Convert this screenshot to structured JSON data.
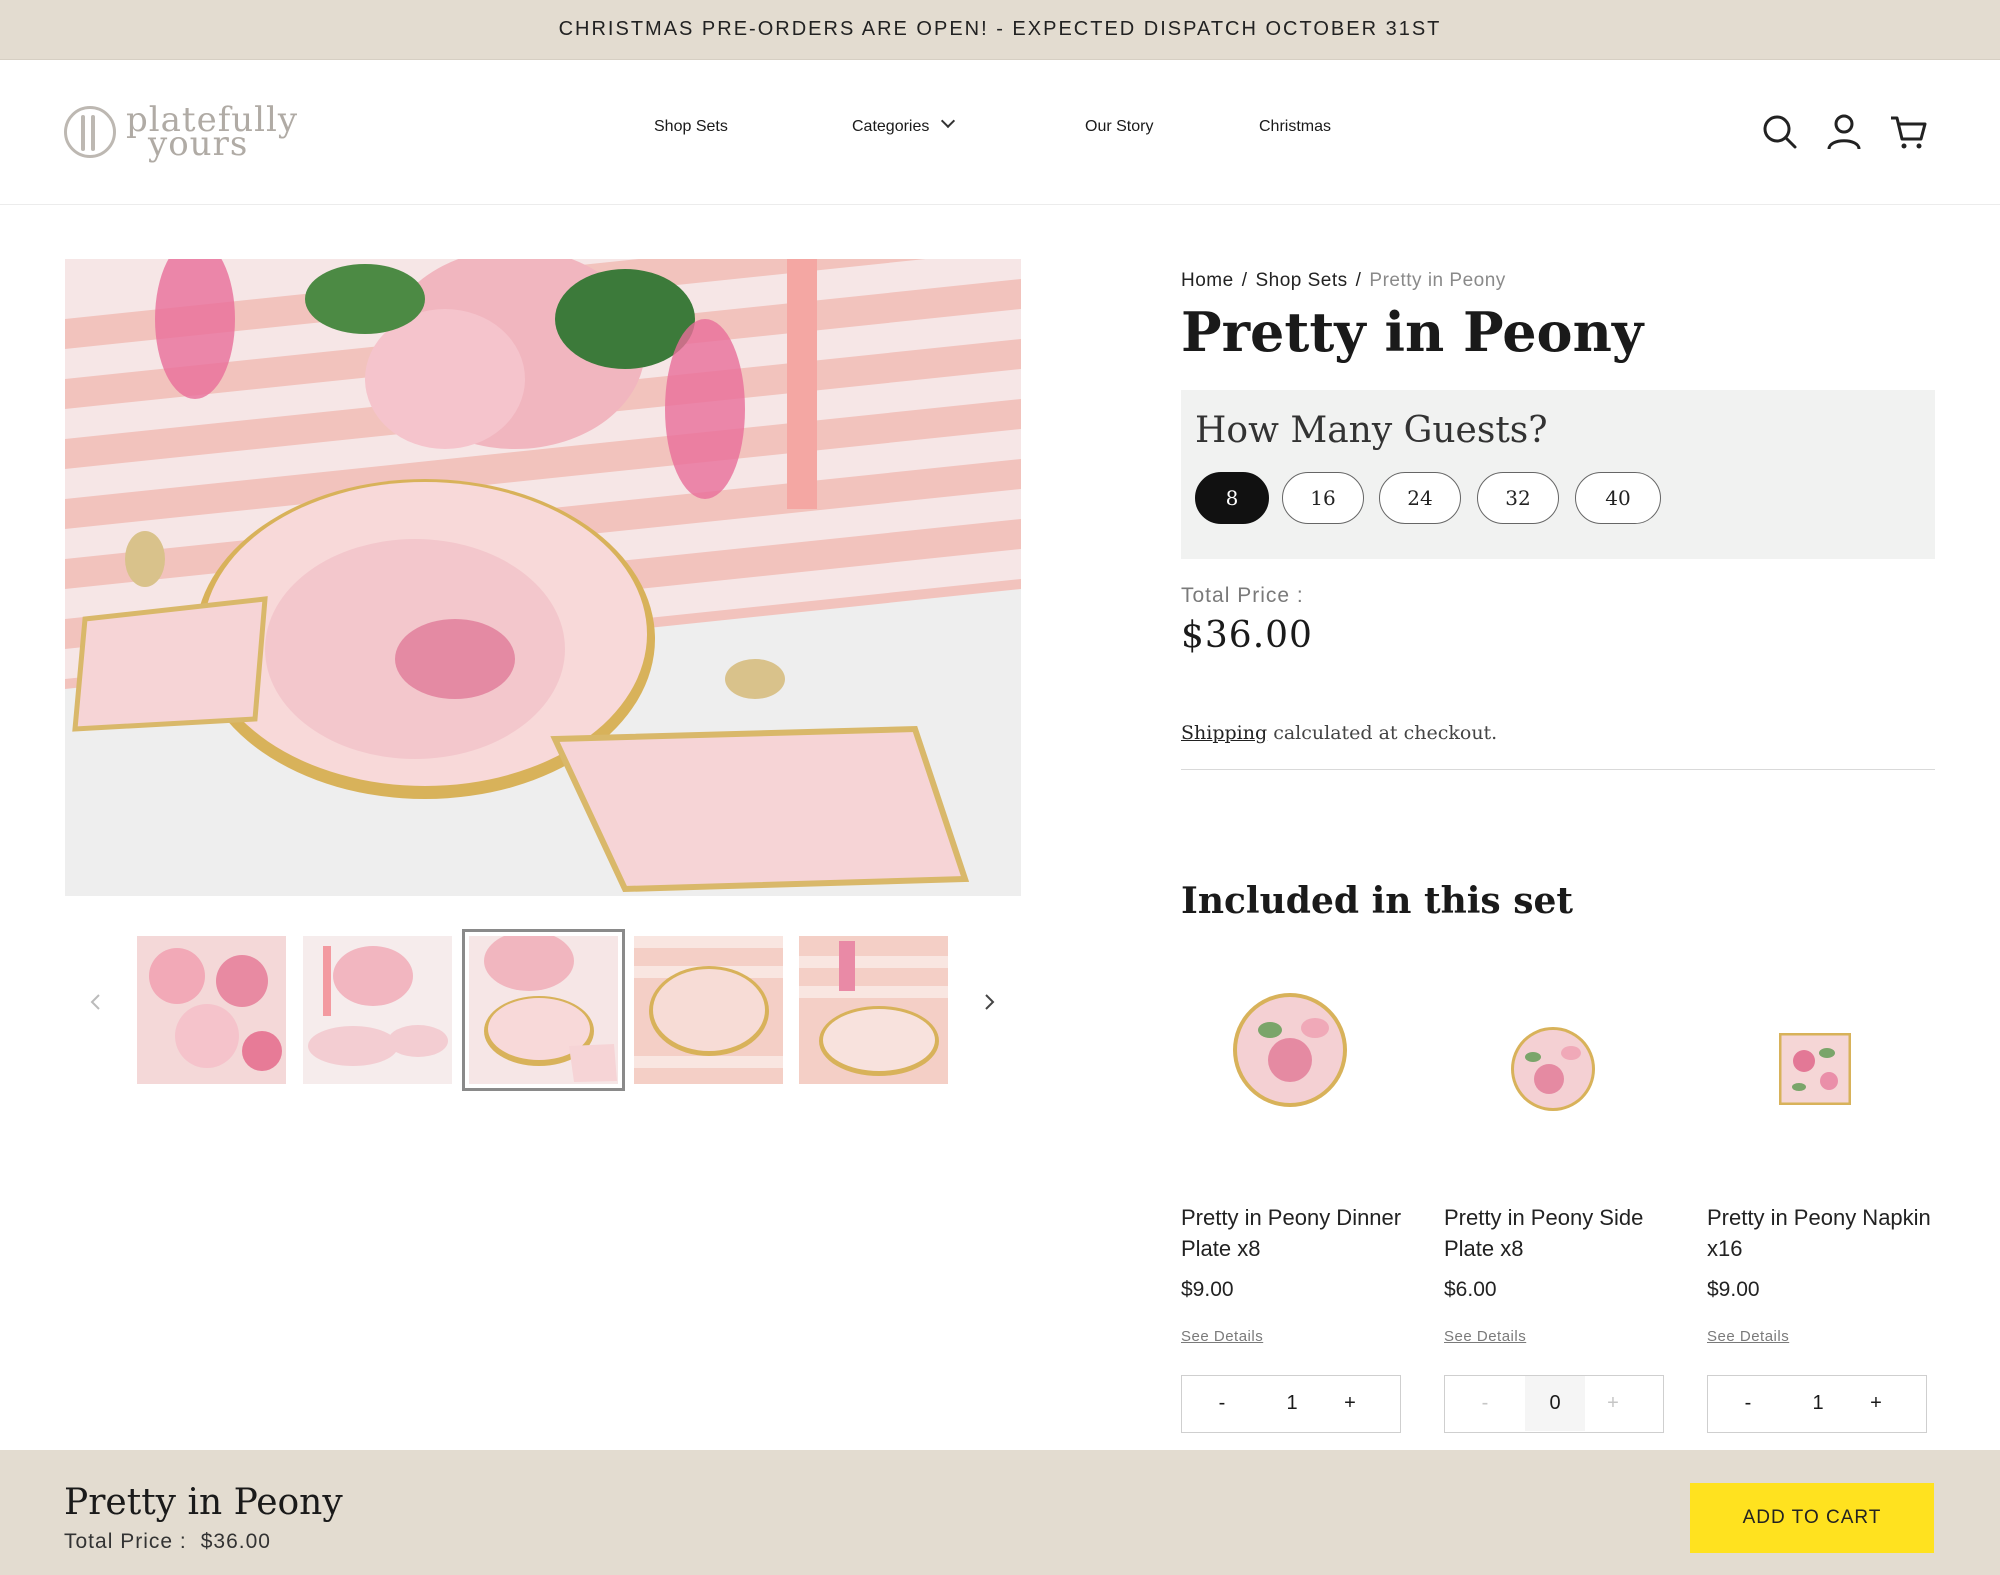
{
  "announcement": "CHRISTMAS PRE-ORDERS ARE OPEN! - EXPECTED DISPATCH OCTOBER 31ST",
  "logo": {
    "line1": "platefully",
    "line2": "yours"
  },
  "nav": {
    "shop_sets": "Shop Sets",
    "categories": "Categories",
    "our_story": "Our Story",
    "christmas": "Christmas"
  },
  "icons": {
    "search": "search-icon",
    "account": "account-icon",
    "cart": "cart-icon",
    "prev": "chevron-left-icon",
    "next": "chevron-right-icon",
    "dropdown": "chevron-down-icon"
  },
  "breadcrumb": {
    "home": "Home",
    "shop_sets": "Shop Sets",
    "current": "Pretty in Peony"
  },
  "product": {
    "title": "Pretty in Peony"
  },
  "guests": {
    "question": "How Many Guests?",
    "options": [
      "8",
      "16",
      "24",
      "32",
      "40"
    ],
    "selected": "8"
  },
  "total": {
    "label": "Total Price :",
    "value": "$36.00"
  },
  "shipping": {
    "link": "Shipping",
    "text": "calculated at checkout."
  },
  "included": {
    "heading": "Included in this set",
    "items": [
      {
        "name": "Pretty in Peony Dinner Plate x8",
        "price": "$9.00",
        "details": "See Details",
        "qty": "1"
      },
      {
        "name": "Pretty in Peony Side Plate x8",
        "price": "$6.00",
        "details": "See Details",
        "qty": "0"
      },
      {
        "name": "Pretty in Peony Napkin x16",
        "price": "$9.00",
        "details": "See Details",
        "qty": "1"
      }
    ],
    "minus": "-",
    "plus": "+"
  },
  "sticky": {
    "title": "Pretty in Peony",
    "price_label": "Total Price :",
    "price_value": "$36.00",
    "button": "ADD TO CART"
  },
  "colors": {
    "accent": "#ffe21f",
    "bar": "#e3dcd0",
    "selected_pill": "#111111",
    "guest_box": "#f1f2f1"
  }
}
